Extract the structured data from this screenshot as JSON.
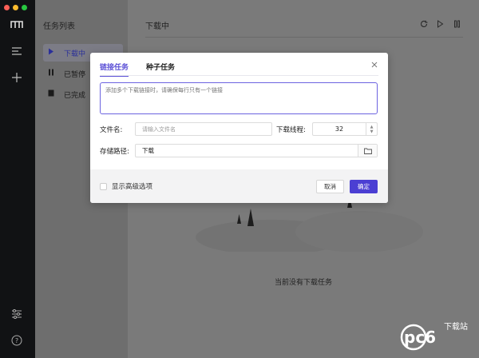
{
  "rail": {
    "icons": [
      "logo-icon",
      "menu-icon",
      "add-icon",
      "settings-sliders-icon",
      "help-icon"
    ]
  },
  "tasklist": {
    "title": "任务列表",
    "items": [
      {
        "label": "下载中",
        "icon": "play-icon",
        "active": true
      },
      {
        "label": "已暂停",
        "icon": "pause-icon",
        "active": false
      },
      {
        "label": "已完成",
        "icon": "stop-icon",
        "active": false
      }
    ]
  },
  "main": {
    "title": "下载中",
    "empty_text": "当前没有下载任务"
  },
  "dialog": {
    "tabs": [
      "链接任务",
      "种子任务"
    ],
    "url_placeholder": "添加多个下载链接时，请确保每行只有一个链接",
    "filename_label": "文件名:",
    "filename_placeholder": "请输入文件名",
    "threads_label": "下载线程:",
    "threads_value": "32",
    "path_label": "存储路径:",
    "path_value": "下载",
    "advanced_label": "显示高级选项",
    "cancel_label": "取消",
    "ok_label": "确定"
  },
  "watermark": {
    "brand": "pc6",
    "site": "下载站"
  },
  "colors": {
    "accent": "#5b4fd6",
    "primary_button": "#4b3fd3",
    "rail": "#111214"
  }
}
